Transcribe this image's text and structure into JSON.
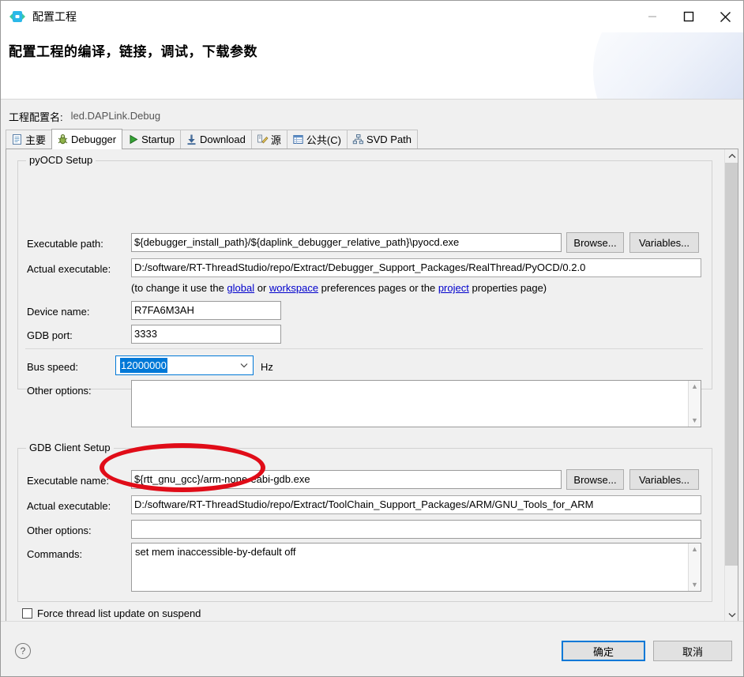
{
  "window": {
    "title": "配置工程",
    "icon": "rt-thread-logo-icon",
    "minimize_label": "minimize-icon",
    "maximize_label": "maximize-icon",
    "close_label": "close-icon"
  },
  "header": {
    "title": "配置工程的编译，链接，调试，下载参数"
  },
  "config_name": {
    "label": "工程配置名:",
    "value": "led.DAPLink.Debug"
  },
  "tabs": [
    {
      "label": "主要",
      "icon": "document-icon",
      "active": false
    },
    {
      "label": "Debugger",
      "icon": "bug-icon",
      "active": true
    },
    {
      "label": "Startup",
      "icon": "play-icon",
      "active": false
    },
    {
      "label": "Download",
      "icon": "download-icon",
      "active": false
    },
    {
      "label": "源",
      "icon": "source-edit-icon",
      "active": false
    },
    {
      "label": "公共(C)",
      "icon": "common-icon",
      "active": false
    },
    {
      "label": "SVD Path",
      "icon": "hierarchy-icon",
      "active": false
    }
  ],
  "pyocd": {
    "group_title": "pyOCD Setup",
    "executable_path": {
      "label": "Executable path:",
      "value": "${debugger_install_path}/${daplink_debugger_relative_path}\\pyocd.exe"
    },
    "browse_label": "Browse...",
    "variables_label": "Variables...",
    "actual_executable": {
      "label": "Actual executable:",
      "value": "D:/software/RT-ThreadStudio/repo/Extract/Debugger_Support_Packages/RealThread/PyOCD/0.2.0"
    },
    "hint": {
      "prefix": "(to change it use the ",
      "link_global": "global",
      "mid1": " or ",
      "link_workspace": "workspace",
      "mid2": " preferences pages or the ",
      "link_project": "project",
      "suffix": " properties page)"
    },
    "device_name": {
      "label": "Device name:",
      "value": "R7FA6M3AH"
    },
    "gdb_port": {
      "label": "GDB port:",
      "value": "3333"
    },
    "bus_speed": {
      "label": "Bus speed:",
      "value": "12000000",
      "unit": "Hz",
      "selected": true,
      "options": [
        "12000000"
      ]
    },
    "other_options": {
      "label": "Other options:",
      "value": ""
    }
  },
  "gdb_client": {
    "group_title": "GDB Client Setup",
    "executable_name": {
      "label": "Executable name:",
      "value": "${rtt_gnu_gcc}/arm-none-eabi-gdb.exe"
    },
    "browse_label": "Browse...",
    "variables_label": "Variables...",
    "actual_executable": {
      "label": "Actual executable:",
      "value": "D:/software/RT-ThreadStudio/repo/Extract/ToolChain_Support_Packages/ARM/GNU_Tools_for_ARM"
    },
    "other_options": {
      "label": "Other options:",
      "value": ""
    },
    "commands": {
      "label": "Commands:",
      "value": "set mem inaccessible-by-default off"
    }
  },
  "force_thread_checkbox": {
    "label": "Force thread list update on suspend",
    "checked": false
  },
  "footer": {
    "help_glyph": "?",
    "ok_label": "确定",
    "cancel_label": "取消"
  },
  "annotation": {
    "shape": "ellipse",
    "color": "#e00c18",
    "target": "bus-speed-combobox"
  },
  "colors": {
    "accent": "#0078d7",
    "annotation_red": "#e00c18",
    "panel_bg": "#f0f0f0",
    "link": "#0000cc"
  }
}
